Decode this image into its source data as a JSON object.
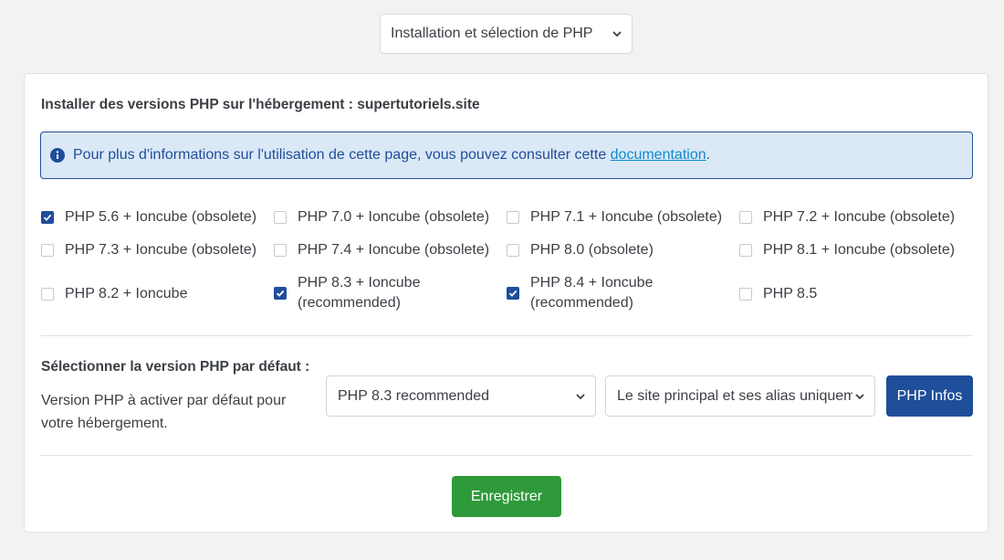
{
  "top_select": {
    "value": "Installation et sélection de PHP"
  },
  "panel": {
    "title": "Installer des versions PHP sur l'hébergement : supertutoriels.site",
    "alert": {
      "text": "Pour plus d'informations sur l'utilisation de cette page, vous pouvez consulter cette ",
      "link": "documentation",
      "suffix": "."
    },
    "versions": [
      {
        "label": "PHP 5.6 + Ioncube (obsolete)",
        "checked": true
      },
      {
        "label": "PHP 7.0 + Ioncube (obsolete)",
        "checked": false
      },
      {
        "label": "PHP 7.1 + Ioncube (obsolete)",
        "checked": false
      },
      {
        "label": "PHP 7.2 + Ioncube (obsolete)",
        "checked": false
      },
      {
        "label": "PHP 7.3 + Ioncube (obsolete)",
        "checked": false
      },
      {
        "label": "PHP 7.4 + Ioncube (obsolete)",
        "checked": false
      },
      {
        "label": "PHP 8.0 (obsolete)",
        "checked": false
      },
      {
        "label": "PHP 8.1 + Ioncube (obsolete)",
        "checked": false
      },
      {
        "label": "PHP 8.2 + Ioncube",
        "checked": false
      },
      {
        "label": "PHP 8.3 + Ioncube (recommended)",
        "checked": true
      },
      {
        "label": "PHP 8.4 + Ioncube (recommended)",
        "checked": true
      },
      {
        "label": "PHP 8.5",
        "checked": false
      }
    ],
    "default_section": {
      "title": "Sélectionner la version PHP par défaut :",
      "description": "Version PHP à activer par défaut pour votre hébergement.",
      "version_select": "PHP 8.3 recommended",
      "scope_select": "Le site principal et ses alias uniquement",
      "info_button": "PHP Infos"
    },
    "save_button": "Enregistrer"
  },
  "colors": {
    "primary": "#1f4e9a",
    "success": "#2e9a3a",
    "alert_bg": "#dbe8f6",
    "link": "#0d8bd1"
  }
}
